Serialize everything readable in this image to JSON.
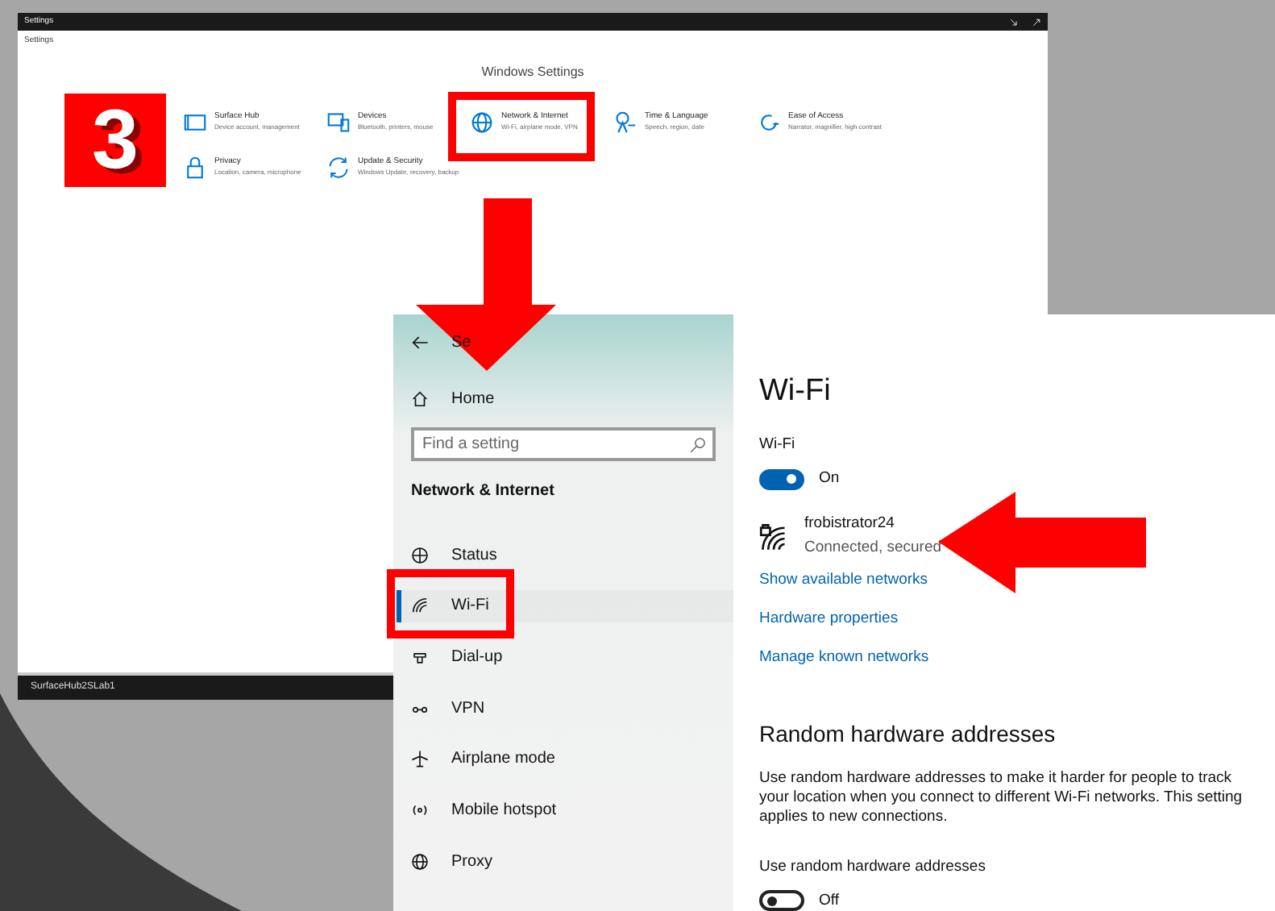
{
  "settings_window": {
    "title": "Settings",
    "breadcrumb": "Settings",
    "heading": "Windows Settings",
    "categories": [
      {
        "title": "Surface Hub",
        "subtitle": "Device account, management"
      },
      {
        "title": "Devices",
        "subtitle": "Bluetooth, printers, mouse"
      },
      {
        "title": "Network & Internet",
        "subtitle": "Wi-Fi, airplane mode, VPN"
      },
      {
        "title": "Time & Language",
        "subtitle": "Speech, region, date"
      },
      {
        "title": "Ease of Access",
        "subtitle": "Narrator, magnifier, high contrast"
      },
      {
        "title": "Privacy",
        "subtitle": "Location, camera, microphone"
      },
      {
        "title": "Update & Security",
        "subtitle": "Windows Update, recovery, backup"
      }
    ],
    "status_bar": "SurfaceHub2SLab1"
  },
  "step_badge": "3",
  "wifi_window": {
    "title": "Se",
    "home": "Home",
    "search": {
      "placeholder": "Find a setting"
    },
    "section": "Network & Internet",
    "nav_items": [
      {
        "label": "Status",
        "selected": false
      },
      {
        "label": "Wi-Fi",
        "selected": true
      },
      {
        "label": "Dial-up",
        "selected": false
      },
      {
        "label": "VPN",
        "selected": false
      },
      {
        "label": "Airplane mode",
        "selected": false
      },
      {
        "label": "Mobile hotspot",
        "selected": false
      },
      {
        "label": "Proxy",
        "selected": false
      }
    ],
    "page_title": "Wi-Fi",
    "wifi_label": "Wi-Fi",
    "wifi_toggle": {
      "on": true,
      "text": "On"
    },
    "network": {
      "name": "frobistrator24",
      "status": "Connected, secured"
    },
    "links": [
      "Show available networks",
      "Hardware properties",
      "Manage known networks"
    ],
    "random_heading": "Random hardware addresses",
    "random_description": "Use random hardware addresses to make it harder for people to track your location when you connect to different Wi-Fi networks. This setting applies to new connections.",
    "random_label": "Use random hardware addresses",
    "random_toggle": {
      "on": false,
      "text": "Off"
    }
  }
}
